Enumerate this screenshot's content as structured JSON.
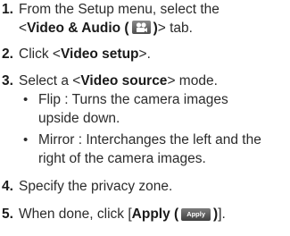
{
  "steps": [
    {
      "num": "1.",
      "line1": "From the Setup menu, select the",
      "line2_prefix": "<",
      "line2_bold": "Video & Audio (",
      "line2_bold_end": ")",
      "line2_suffix": "> tab."
    },
    {
      "num": "2.",
      "prefix": "Click <",
      "bold": "Video setup",
      "suffix": ">."
    },
    {
      "num": "3.",
      "prefix": "Select a <",
      "bold": "Video source",
      "suffix": "> mode."
    },
    {
      "num": "4.",
      "text": "Specify the privacy zone."
    },
    {
      "num": "5.",
      "prefix": "When done, click [",
      "bold": "Apply (",
      "bold_end": ")",
      "suffix": "]."
    }
  ],
  "bullets": [
    {
      "marker": "•",
      "line1": "Flip : Turns the camera images",
      "line2": "upside down."
    },
    {
      "marker": "•",
      "line1": "Mirror : Interchanges the left and the",
      "line2": "right of the camera images."
    }
  ],
  "icons": {
    "video_audio_tab": "camera-reel-icon"
  },
  "apply_button_label": "Apply"
}
